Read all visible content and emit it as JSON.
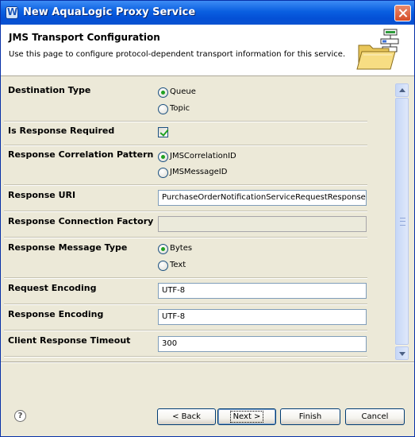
{
  "window": {
    "title": "New AquaLogic Proxy Service"
  },
  "header": {
    "title": "JMS Transport Configuration",
    "description": "Use this page to configure protocol-dependent transport information for this service.",
    "icon": "wizard-folder-icon"
  },
  "form": {
    "destination_type": {
      "label": "Destination Type",
      "options": [
        "Queue",
        "Topic"
      ],
      "selected": "Queue"
    },
    "response_required": {
      "label": "Is Response Required",
      "checked": true
    },
    "correlation_pattern": {
      "label": "Response Correlation Pattern",
      "options": [
        "JMSCorrelationID",
        "JMSMessageID"
      ],
      "selected": "JMSCorrelationID"
    },
    "response_uri": {
      "label": "Response URI",
      "value": "PurchaseOrderNotificationServiceRequestResponse"
    },
    "response_connection_factory": {
      "label": "Response Connection Factory",
      "value": "",
      "enabled": false
    },
    "response_message_type": {
      "label": "Response Message Type",
      "options": [
        "Bytes",
        "Text"
      ],
      "selected": "Bytes"
    },
    "request_encoding": {
      "label": "Request Encoding",
      "value": "UTF-8"
    },
    "response_encoding": {
      "label": "Response Encoding",
      "value": "UTF-8"
    },
    "client_response_timeout": {
      "label": "Client Response Timeout",
      "value": "300"
    }
  },
  "buttons": {
    "back": "< Back",
    "next": "Next >",
    "finish": "Finish",
    "cancel": "Cancel"
  },
  "colors": {
    "titlebar": "#0a5fe0",
    "radio_dot": "#21a121",
    "dialog_bg": "#ece9d8",
    "input_border": "#7f9db9"
  }
}
